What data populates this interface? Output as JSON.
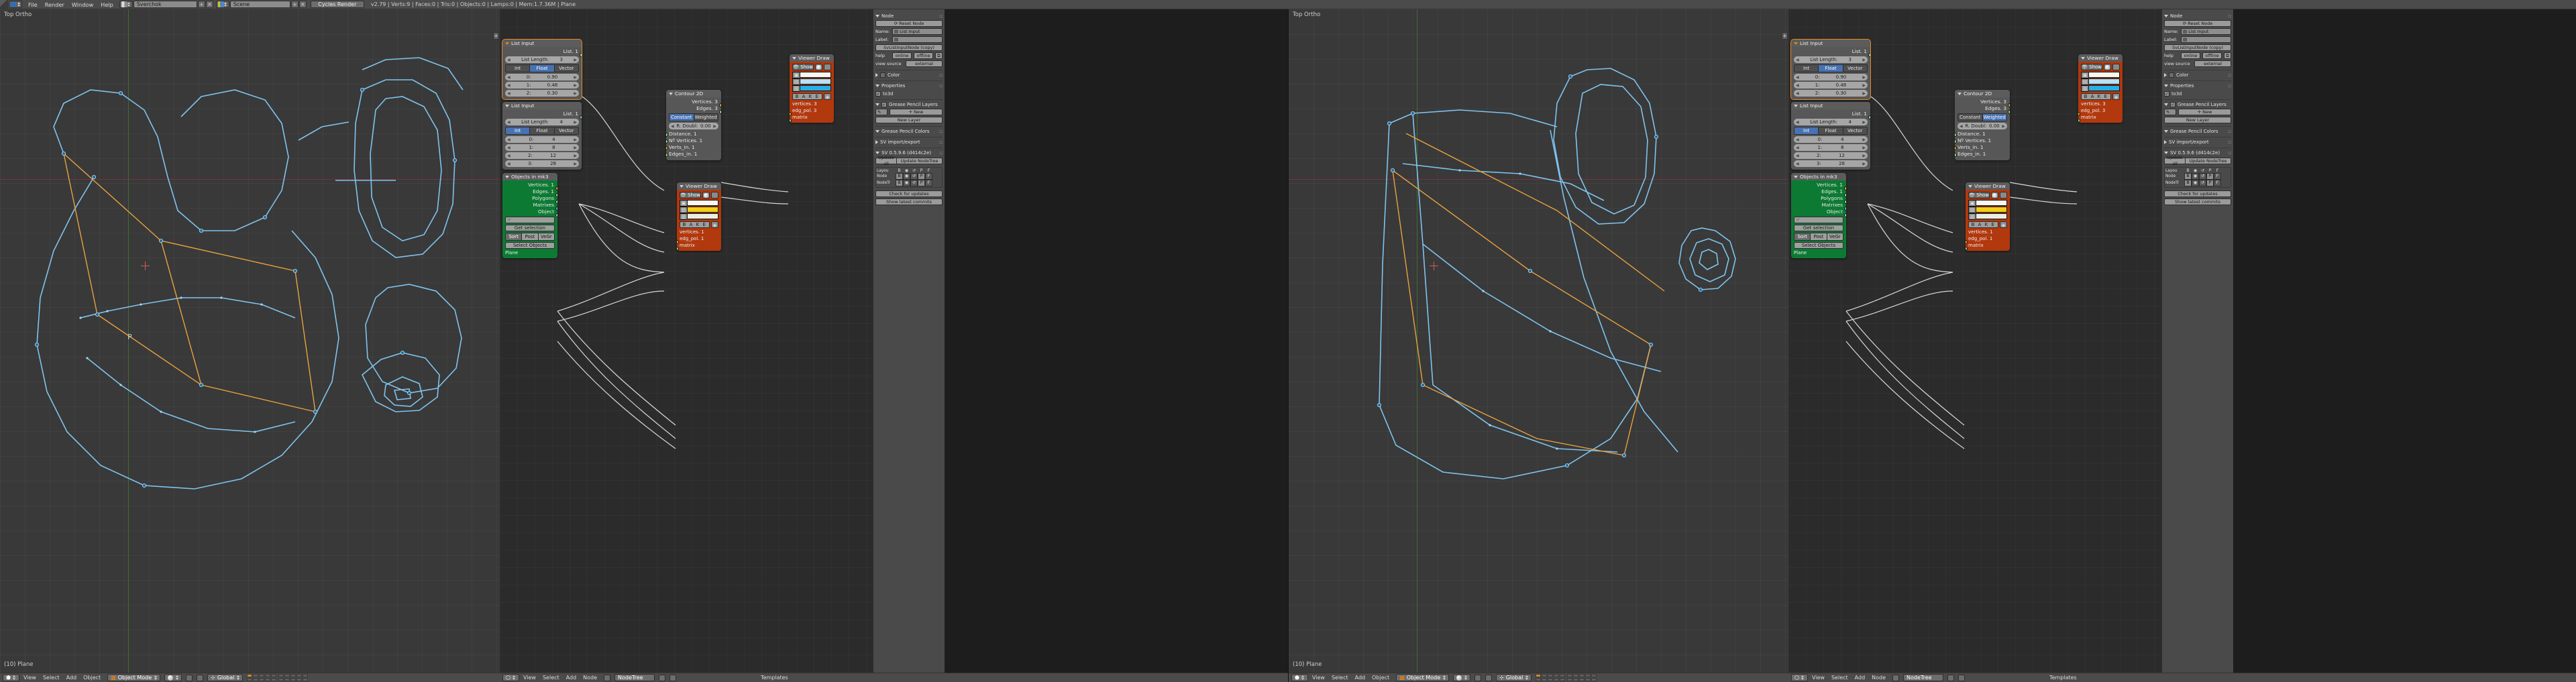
{
  "topbar": {
    "info_icon": "info-icon",
    "menus": [
      "File",
      "Render",
      "Window",
      "Help"
    ],
    "screen_layout": "Sverchok",
    "scene": "Scene",
    "engine": "Cycles Render",
    "stats": "v2.79 | Verts:9 | Faces:0 | Tris:0 | Objects:0 | Lamps:0 | Mem:1.7.36M | Plane"
  },
  "viewport": {
    "view_label": "Top Ortho",
    "object_info": "(10) Plane"
  },
  "node_editor": {
    "nodes": {
      "list_input_1": {
        "title": "List Input",
        "output": "List. 1",
        "length_label": "List Length:",
        "length_value": "3",
        "modes": [
          "Int",
          "Float",
          "Vector"
        ],
        "active_mode": "Float",
        "values": [
          {
            "index": "0:",
            "value": "0.90"
          },
          {
            "index": "1:",
            "value": "0.48"
          },
          {
            "index": "2:",
            "value": "0.30"
          }
        ]
      },
      "list_input_2": {
        "title": "List Input",
        "output": "List. 1",
        "length_label": "List Length:",
        "length_value": "4",
        "modes": [
          "Int",
          "Float",
          "Vector"
        ],
        "active_mode": "Int",
        "values": [
          {
            "index": "0:",
            "value": "4"
          },
          {
            "index": "1:",
            "value": "8"
          },
          {
            "index": "2:",
            "value": "12"
          },
          {
            "index": "3:",
            "value": "28"
          }
        ]
      },
      "contour_2d": {
        "title": "Contour 2D",
        "outputs": [
          "Vertices. 3",
          "Edges. 3"
        ],
        "modes": [
          "Constant",
          "Weighted"
        ],
        "active_mode": "Constant",
        "remove_doubles_label": "R. Doubl:",
        "remove_doubles_value": "0.00",
        "inputs": [
          "Distance. 1",
          "Nº Vertices. 1",
          "Verts_in. 1",
          "Edges_in. 1"
        ]
      },
      "viewer_draw_1": {
        "title": "Viewer Draw",
        "show_label": "Show",
        "colors": [
          "#f8f6ef",
          "#b9e0f5",
          "#27b0e8"
        ],
        "bake_label": "B A K E",
        "inputs": [
          "vertices. 3",
          "edg_pol. 3",
          "matrix"
        ]
      },
      "objects_in_mk3": {
        "title": "Objects in mk3",
        "outputs": [
          "Vertices. 1",
          "Edges. 1",
          "Polygons",
          "Matrixes",
          "Object"
        ],
        "get_selection_label": "Get selection",
        "modes": [
          "Sort",
          "Post",
          "VeGr"
        ],
        "active_mode": "Sort",
        "select_objects_label": "Select Objects",
        "object_name": "Plane"
      },
      "viewer_draw_2": {
        "title": "Viewer Draw",
        "show_label": "Show",
        "colors": [
          "#f8f6ef",
          "#f2d019",
          "#e8f0e4"
        ],
        "bake_label": "B A K E",
        "inputs": [
          "vertices. 1",
          "edg_pol. 1",
          "matrix"
        ]
      }
    }
  },
  "npanel": {
    "node_section": "Node",
    "reset_node": "Reset Node",
    "name_label": "Name:",
    "name_value": "List Input",
    "label_label": "Label:",
    "label_value": "",
    "class_name": "SvListInputNode (copy)",
    "help_label": "help",
    "help_online": "online",
    "help_offline": "offline",
    "view_source_label": "view source",
    "view_source_external": "external",
    "color_section": "Color",
    "properties_section": "Properties",
    "to3d_label": "to3d",
    "grease_pencil_layers": "Grease Pencil Layers",
    "new_button": "New",
    "new_layer_button": "New Layer",
    "grease_pencil_colors": "Grease Pencil Colors",
    "sv_import_export": "SV import/export",
    "sv_version": "SV 0.5.9.6 (d414c2e)",
    "update_all": "Update all",
    "update_nodetree": "Update NodeTree",
    "matrix_rows": [
      {
        "name": "Layou",
        "cells": [
          "B",
          "◉",
          "↺",
          "P",
          "F"
        ]
      },
      {
        "name": "Node",
        "cells": [
          "B",
          "◉",
          "↺",
          "P",
          "F"
        ]
      },
      {
        "name": "NodeTr",
        "cells": [
          "B",
          "◉",
          "↺",
          "P",
          "F"
        ]
      }
    ],
    "check_updates": "Check for updates",
    "show_commits": "Show latest commits"
  },
  "viewport_footer": {
    "menus": [
      "View",
      "Select",
      "Add",
      "Object"
    ],
    "mode": "Object Mode",
    "orientation": "Global"
  },
  "node_footer": {
    "menus": [
      "View",
      "Select",
      "Add",
      "Node"
    ],
    "tree_name": "NodeTree",
    "templates": "Templates"
  },
  "colors": {
    "accent_orange": "#e8830f",
    "node_red": "#b2380e",
    "node_green": "#0d7a33",
    "socket_vertices": "#e8a02a",
    "socket_edges": "#8ce38c",
    "socket_matrix": "#2fc8d8",
    "mesh_blue": "#7fc4ef",
    "mesh_orange": "#e8a33d"
  }
}
